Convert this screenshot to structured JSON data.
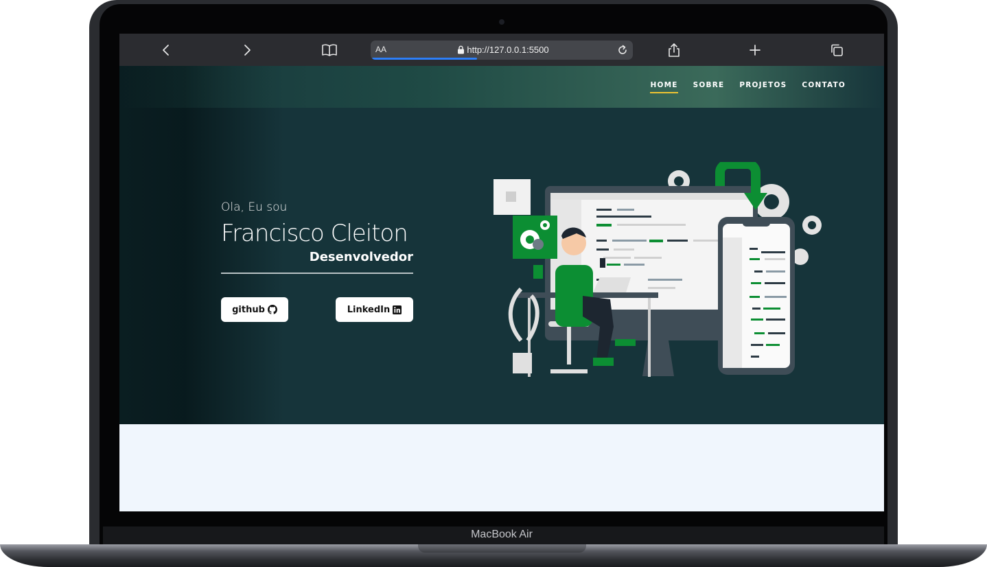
{
  "browser": {
    "text_size_label": "AA",
    "url": "http://127.0.0.1:5500",
    "load_progress": 0.4
  },
  "nav": {
    "items": [
      "HOME",
      "SOBRE",
      "PROJETOS",
      "CONTATO"
    ],
    "active": "HOME"
  },
  "hero": {
    "greeting": "Ola, Eu sou",
    "name": "Francisco Cleiton",
    "role": "Desenvolvedor",
    "buttons": {
      "github": "github",
      "linkedin": "LinkedIn"
    }
  },
  "device": {
    "label": "MacBook Air"
  },
  "colors": {
    "hero_bg": "#16343a",
    "nav_underline": "#f0c432",
    "section_bg": "#f0f6fd",
    "illustration_green": "#0c8e33"
  },
  "icons": [
    "chevron-left-icon",
    "chevron-right-icon",
    "book-icon",
    "lock-icon",
    "reload-icon",
    "share-icon",
    "plus-icon",
    "tabs-icon",
    "github-icon",
    "linkedin-icon"
  ]
}
